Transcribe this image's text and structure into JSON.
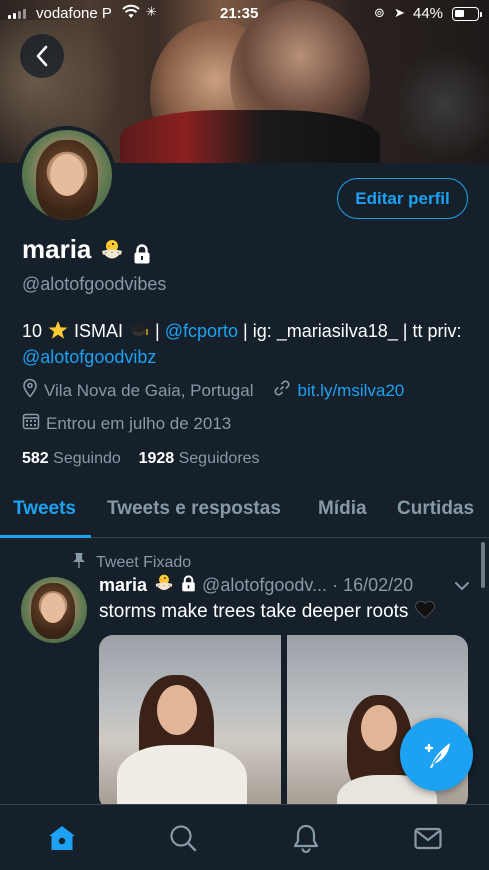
{
  "status_bar": {
    "carrier": "vodafone P",
    "time": "21:35",
    "battery_pct": "44%",
    "battery_level": 0.44
  },
  "header": {
    "back_icon": "chevron-left-icon"
  },
  "profile": {
    "edit_button": "Editar perfil",
    "name": "maria",
    "name_emoji_icon": "hatching-chick-icon",
    "protected_icon": "lock-icon",
    "handle": "@alotofgoodvibes",
    "bio_part1": "10 ",
    "bio_star_icon": "glowing-star-icon",
    "bio_part2": " ISMAI ",
    "bio_cap_icon": "graduation-cap-icon",
    "bio_part3": " | ",
    "bio_mention1": "@fcporto",
    "bio_part4": " | ig: _mariasilva18_ | tt priv: ",
    "bio_mention2": "@alotofgoodvibz",
    "location": "Vila Nova de Gaia, Portugal",
    "link": "bit.ly/msilva20",
    "joined": "Entrou em julho de 2013",
    "following_count": "582",
    "following_label": "Seguindo",
    "followers_count": "1928",
    "followers_label": "Seguidores"
  },
  "tabs": [
    {
      "label": "Tweets",
      "active": true
    },
    {
      "label": "Tweets e respostas",
      "active": false
    },
    {
      "label": "Mídia",
      "active": false
    },
    {
      "label": "Curtidas",
      "active": false
    }
  ],
  "pinned_tweet": {
    "pinned_label": "Tweet Fixado",
    "name": "maria",
    "handle_date": "@alotofgoodv... · 16/02/20",
    "text": "storms make trees take deeper roots",
    "text_emoji_icon": "black-heart-icon"
  },
  "bottom_nav": [
    {
      "name": "home",
      "icon": "home-icon",
      "active": true
    },
    {
      "name": "search",
      "icon": "search-icon",
      "active": false
    },
    {
      "name": "notifications",
      "icon": "bell-icon",
      "active": false
    },
    {
      "name": "messages",
      "icon": "mail-icon",
      "active": false
    }
  ],
  "colors": {
    "background": "#15202b",
    "accent": "#1da1f2",
    "secondary_text": "#8899a6",
    "divider": "#38444d"
  }
}
